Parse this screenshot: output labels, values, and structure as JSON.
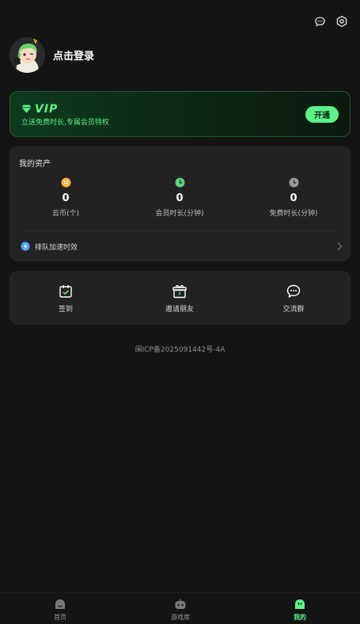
{
  "header": {
    "icons": [
      "chat-bubble-icon",
      "settings-hexagon-icon"
    ]
  },
  "profile": {
    "login_text": "点击登录"
  },
  "vip": {
    "title": "VIP",
    "subtitle": "立送免费时长,专属会员特权",
    "button_label": "开通",
    "accent_color": "#5bf28a"
  },
  "assets": {
    "title": "我的资产",
    "items": [
      {
        "icon": "coin-icon",
        "value": "0",
        "label": "云币(个)"
      },
      {
        "icon": "member-clock-icon",
        "value": "0",
        "label": "会员时长(分钟)"
      },
      {
        "icon": "free-clock-icon",
        "value": "0",
        "label": "免费时长(分钟)"
      }
    ],
    "queue_label": "排队加速时效"
  },
  "actions": [
    {
      "icon": "checkin-calendar-icon",
      "label": "签到"
    },
    {
      "icon": "gift-icon",
      "label": "邀请朋友"
    },
    {
      "icon": "group-chat-icon",
      "label": "交流群"
    }
  ],
  "footer": {
    "icp": "闽ICP备2025091442号-4A"
  },
  "tabbar": {
    "tabs": [
      {
        "icon": "home-icon",
        "label": "首页",
        "active": false
      },
      {
        "icon": "game-library-icon",
        "label": "游戏库",
        "active": false
      },
      {
        "icon": "profile-face-icon",
        "label": "我的",
        "active": true
      }
    ]
  }
}
